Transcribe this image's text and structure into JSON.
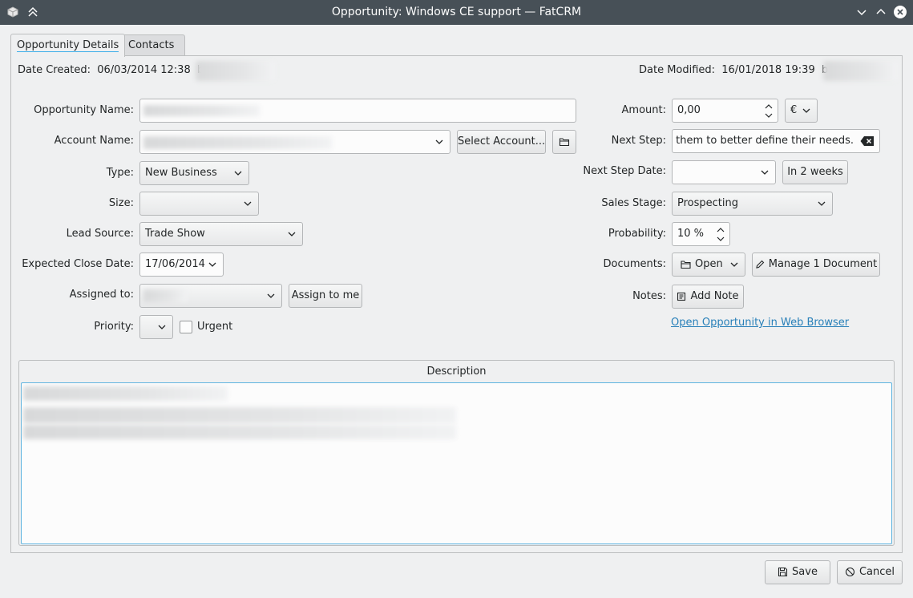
{
  "window": {
    "title": "Opportunity: Windows CE support — FatCRM"
  },
  "tabs": [
    {
      "label": "Opportunity Details"
    },
    {
      "label": "Contacts"
    }
  ],
  "meta": {
    "created_label": "Date Created:",
    "created_value": "06/03/2014 12:38",
    "created_by": "by",
    "modified_label": "Date Modified:",
    "modified_value": "16/01/2018 19:39",
    "modified_by": "by"
  },
  "form_left": {
    "opportunity_name_label": "Opportunity Name:",
    "account_name_label": "Account Name:",
    "select_account_button": "Select Account...",
    "type_label": "Type:",
    "type_value": "New Business",
    "size_label": "Size:",
    "size_value": "",
    "lead_source_label": "Lead Source:",
    "lead_source_value": "Trade Show",
    "expected_close_label": "Expected Close Date:",
    "expected_close_value": "17/06/2014",
    "assigned_label": "Assigned to:",
    "assign_to_me_button": "Assign to me",
    "priority_label": "Priority:",
    "priority_value": "",
    "urgent_label": "Urgent",
    "urgent_checked": false
  },
  "form_right": {
    "amount_label": "Amount:",
    "amount_value": "0,00",
    "currency_value": "€",
    "next_step_label": "Next Step:",
    "next_step_value": "act them to better define their needs.",
    "next_step_date_label": "Next Step Date:",
    "next_step_date_value": "",
    "in_2_weeks_button": "In 2 weeks",
    "sales_stage_label": "Sales Stage:",
    "sales_stage_value": "Prospecting",
    "probability_label": "Probability:",
    "probability_value": "10 %",
    "documents_label": "Documents:",
    "open_button": "Open",
    "manage_documents_button": "Manage 1 Document",
    "notes_label": "Notes:",
    "add_note_button": "Add Note",
    "open_in_browser_link": "Open Opportunity in Web Browser"
  },
  "description": {
    "title": "Description"
  },
  "footer": {
    "save_button": "Save",
    "cancel_button": "Cancel"
  },
  "colors": {
    "titlebar": "#475057",
    "accent": "#3daee9",
    "link": "#2980b9"
  },
  "icons": {
    "app": "app-icon",
    "keep_above": "keep-above-icon",
    "minimize": "minimize-icon",
    "maximize": "maximize-icon",
    "close": "close-icon",
    "folder": "folder-icon",
    "clear": "clear-text-icon",
    "pencil": "pencil-icon",
    "note": "note-icon",
    "save": "save-icon",
    "cancel": "cancel-icon"
  }
}
